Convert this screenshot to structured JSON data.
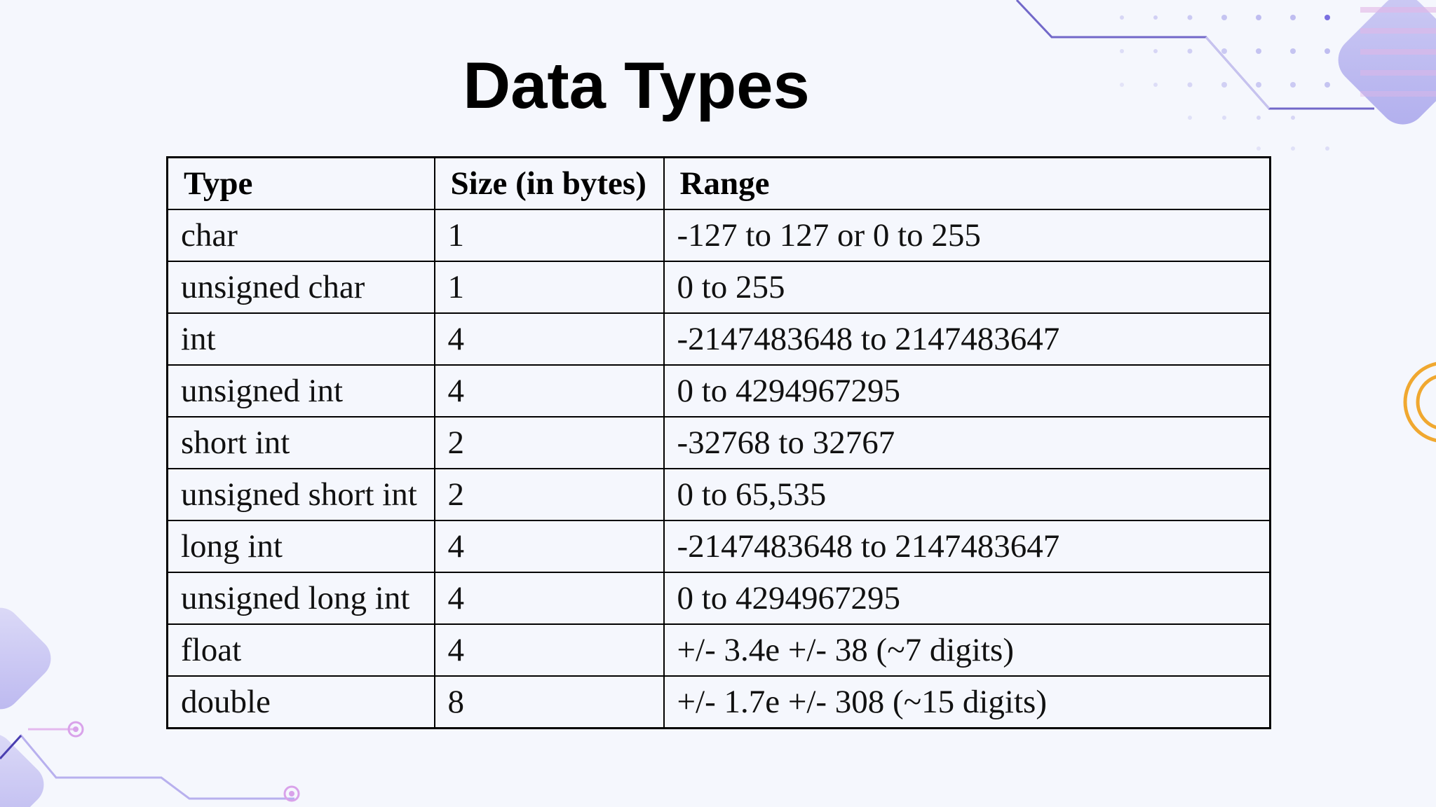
{
  "slide": {
    "title": "Data Types"
  },
  "table": {
    "headers": [
      "Type",
      "Size (in bytes)",
      "Range"
    ],
    "rows": [
      [
        "char",
        "1",
        "-127 to 127 or 0 to 255"
      ],
      [
        "unsigned char",
        "1",
        "0 to 255"
      ],
      [
        "int",
        "4",
        "-2147483648 to 2147483647"
      ],
      [
        "unsigned int",
        "4",
        "0 to 4294967295"
      ],
      [
        "short int",
        "2",
        "-32768 to 32767"
      ],
      [
        "unsigned short int",
        "2",
        "0 to 65,535"
      ],
      [
        "long int",
        "4",
        "-2147483648 to 2147483647"
      ],
      [
        "unsigned long int",
        "4",
        "0 to 4294967295"
      ],
      [
        "float",
        "4",
        "+/- 3.4e +/- 38 (~7 digits)"
      ],
      [
        "double",
        "8",
        "+/- 1.7e +/- 308 (~15 digits)"
      ]
    ]
  },
  "theme": {
    "background": "#f5f7fd",
    "accent_lavender": "#b9b9f0",
    "accent_line": "#5a4fc0",
    "accent_orange": "#f0a830"
  }
}
